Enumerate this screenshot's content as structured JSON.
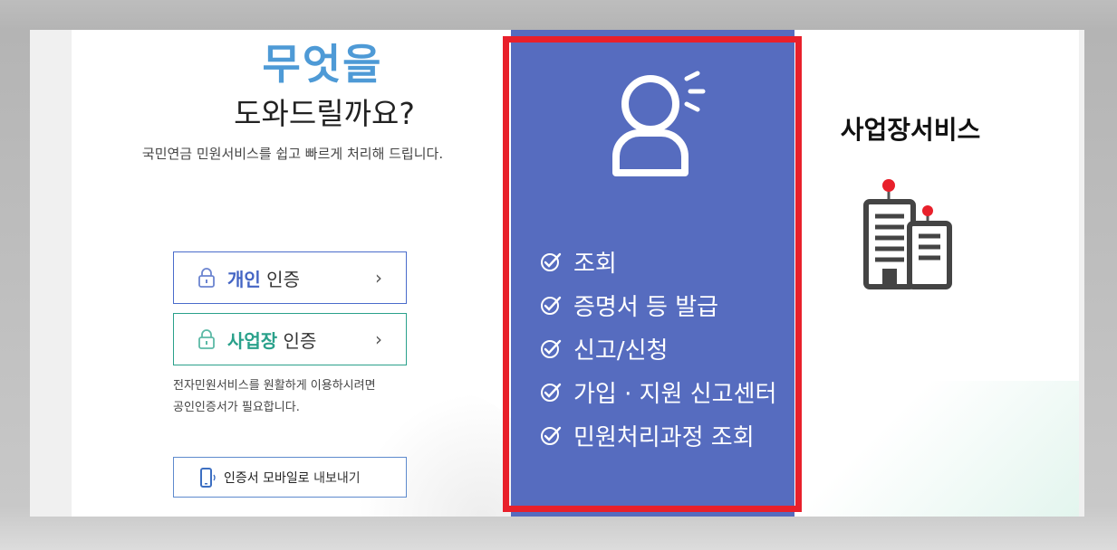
{
  "headline": "무엇을",
  "subheadline": "도와드릴까요?",
  "description": "국민연금 민원서비스를 쉽고 빠르게 처리해 드립니다.",
  "auth": {
    "personal": {
      "strong": "개인",
      "suffix": " 인증",
      "chevron": "›"
    },
    "business": {
      "strong": "사업장",
      "suffix": " 인증",
      "chevron": "›"
    }
  },
  "notice": {
    "line1": "전자민원서비스를 원활하게 이용하시려면",
    "line2": "공인인증서가 필요합니다."
  },
  "mobile_export": {
    "strong": "인증서 모바일로",
    "rest": " 내보내기"
  },
  "personal_service": {
    "items": [
      "조회",
      "증명서 등 발급",
      "신고/신청",
      "가입 · 지원 신고센터",
      "민원처리과정 조회"
    ]
  },
  "business_service": {
    "title": "사업장서비스"
  },
  "icons": {
    "lock": "lock-icon",
    "phone": "mobile-phone-icon",
    "person": "person-icon",
    "check": "check-circle-icon",
    "building": "building-icon"
  },
  "colors": {
    "accent_blue": "#4e9ad6",
    "personal_blue": "#4465c4",
    "business_green": "#2aa18b",
    "panel_bg": "#566cbf",
    "highlight_red": "#e8202b"
  }
}
